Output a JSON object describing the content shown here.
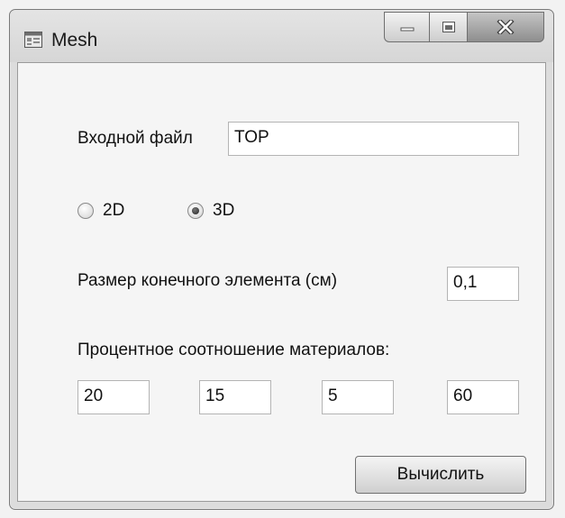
{
  "window": {
    "title": "Mesh",
    "icon": "form-window-icon",
    "caption_buttons": {
      "minimize": "minimize-icon",
      "maximize": "maximize-icon",
      "close": "close-icon"
    }
  },
  "form": {
    "input_file": {
      "label": "Входной файл",
      "value": "TOP"
    },
    "dimension": {
      "options": [
        "2D",
        "3D"
      ],
      "selected": "3D"
    },
    "element_size": {
      "label": "Размер конечного элемента (см)",
      "value": "0,1"
    },
    "materials": {
      "label": "Процентное соотношение материалов:",
      "values": [
        "20",
        "15",
        "5",
        "60"
      ]
    },
    "calculate_button": "Вычислить"
  }
}
